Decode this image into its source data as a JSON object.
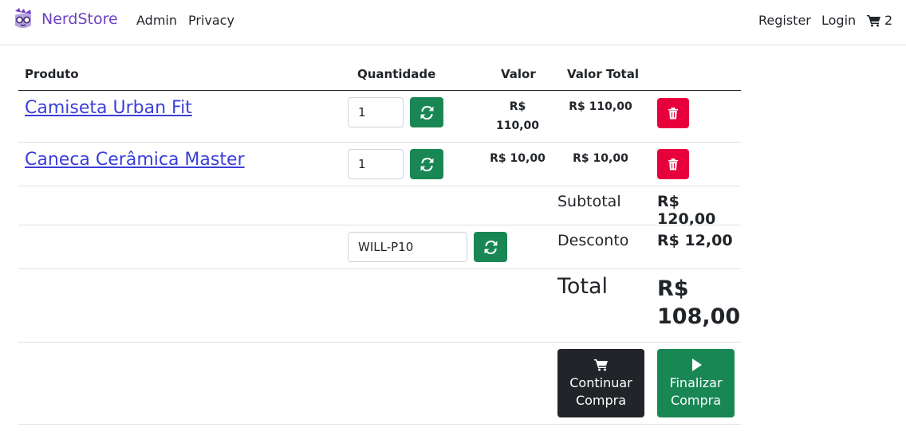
{
  "navbar": {
    "brand": "NerdStore",
    "links": [
      "Admin",
      "Privacy"
    ],
    "register": "Register",
    "login": "Login",
    "cart_count": "2"
  },
  "table": {
    "headers": {
      "product": "Produto",
      "quantity": "Quantidade",
      "value": "Valor",
      "total_value": "Valor Total"
    },
    "rows": [
      {
        "product": "Camiseta Urban Fit",
        "quantity": "1",
        "value_line1": "R$",
        "value_line2": "110,00",
        "total": "R$ 110,00"
      },
      {
        "product": "Caneca Cerâmica Master",
        "quantity": "1",
        "value": "R$ 10,00",
        "total": "R$ 10,00"
      }
    ]
  },
  "summary": {
    "subtotal_label": "Subtotal",
    "subtotal_value": "R$ 120,00",
    "coupon_value": "WILL-P10",
    "discount_label": "Desconto",
    "discount_value": "R$ 12,00",
    "total_label": "Total",
    "total_value_line1": "R$",
    "total_value_line2": "108,00"
  },
  "actions": {
    "continue_line1": "Continuar",
    "continue_line2": "Compra",
    "finish_line1": "Finalizar",
    "finish_line2": "Compra"
  },
  "colors": {
    "brand": "#6f42c1",
    "success": "#198754",
    "danger": "#e8003d",
    "dark": "#212529",
    "link": "#3a3fd8"
  },
  "icons": {
    "brand": "nerd-logo-icon",
    "cart": "shopping-cart-icon",
    "refresh": "refresh-icon",
    "delete": "trash-icon",
    "play": "play-icon"
  }
}
